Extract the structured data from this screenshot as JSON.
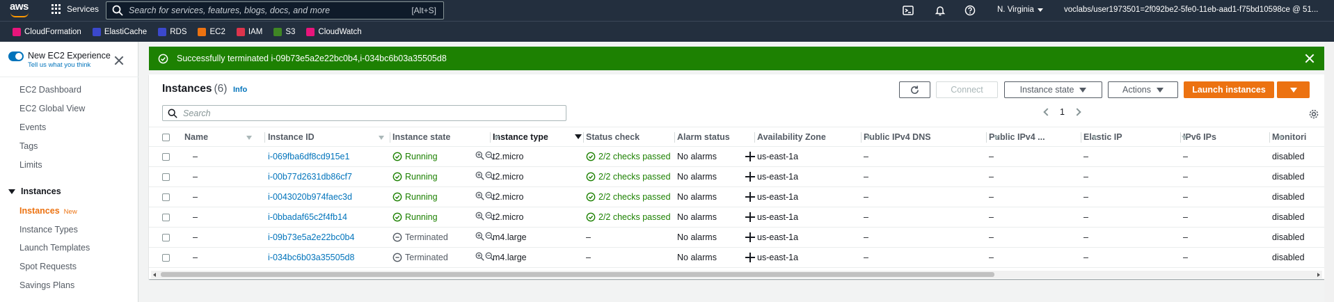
{
  "nav": {
    "logo_text": "aws",
    "services_label": "Services",
    "search_placeholder": "Search for services, features, blogs, docs, and more",
    "search_shortcut": "[Alt+S]",
    "region": "N. Virginia",
    "account": "voclabs/user1973501=2f092be2-5fe0-11eb-aad1-f75bd10598ce @ 51..."
  },
  "favorites": [
    {
      "label": "CloudFormation",
      "color": "#e7157b",
      "icon": "cloudformation-icon"
    },
    {
      "label": "ElastiCache",
      "color": "#3b48cc",
      "icon": "elasticache-icon"
    },
    {
      "label": "RDS",
      "color": "#3b48cc",
      "icon": "rds-icon"
    },
    {
      "label": "EC2",
      "color": "#ec7211",
      "icon": "ec2-icon"
    },
    {
      "label": "IAM",
      "color": "#dd344c",
      "icon": "iam-icon"
    },
    {
      "label": "S3",
      "color": "#3f8624",
      "icon": "s3-icon"
    },
    {
      "label": "CloudWatch",
      "color": "#e7157b",
      "icon": "cloudwatch-icon"
    }
  ],
  "sidebar": {
    "new_experience": "New EC2 Experience",
    "new_experience_sub": "Tell us what you think",
    "items": [
      "EC2 Dashboard",
      "EC2 Global View",
      "Events",
      "Tags",
      "Limits"
    ],
    "section_label": "Instances",
    "section_items": [
      {
        "label": "Instances",
        "tag": "New",
        "active": true
      },
      {
        "label": "Instance Types"
      },
      {
        "label": "Launch Templates"
      },
      {
        "label": "Spot Requests"
      },
      {
        "label": "Savings Plans"
      }
    ]
  },
  "flash": {
    "message": "Successfully terminated i-09b73e5a2e22bc0b4,i-034bc6b03a35505d8",
    "color": "#1d8102"
  },
  "panel": {
    "title": "Instances",
    "count": "(6)",
    "info": "Info",
    "connect": "Connect",
    "instance_state": "Instance state",
    "actions": "Actions",
    "launch": "Launch instances",
    "search_placeholder": "Search",
    "page": "1"
  },
  "table": {
    "columns": [
      "Name",
      "Instance ID",
      "Instance state",
      "Instance type",
      "Status check",
      "Alarm status",
      "Availability Zone",
      "Public IPv4 DNS",
      "Public IPv4 ...",
      "Elastic IP",
      "IPv6 IPs",
      "Monitori"
    ],
    "rows": [
      {
        "name": "–",
        "id": "i-069fba6df8cd915e1",
        "state": "Running",
        "type": "t2.micro",
        "check": "2/2 checks passed",
        "alarm": "No alarms",
        "az": "us-east-1a",
        "dns": "–",
        "ipv4": "–",
        "eip": "–",
        "ipv6": "–",
        "mon": "disabled"
      },
      {
        "name": "–",
        "id": "i-00b77d2631db86cf7",
        "state": "Running",
        "type": "t2.micro",
        "check": "2/2 checks passed",
        "alarm": "No alarms",
        "az": "us-east-1a",
        "dns": "–",
        "ipv4": "–",
        "eip": "–",
        "ipv6": "–",
        "mon": "disabled"
      },
      {
        "name": "–",
        "id": "i-0043020b974faec3d",
        "state": "Running",
        "type": "t2.micro",
        "check": "2/2 checks passed",
        "alarm": "No alarms",
        "az": "us-east-1a",
        "dns": "–",
        "ipv4": "–",
        "eip": "–",
        "ipv6": "–",
        "mon": "disabled"
      },
      {
        "name": "–",
        "id": "i-0bbadaf65c2f4fb14",
        "state": "Running",
        "type": "t2.micro",
        "check": "2/2 checks passed",
        "alarm": "No alarms",
        "az": "us-east-1a",
        "dns": "–",
        "ipv4": "–",
        "eip": "–",
        "ipv6": "–",
        "mon": "disabled"
      },
      {
        "name": "–",
        "id": "i-09b73e5a2e22bc0b4",
        "state": "Terminated",
        "type": "m4.large",
        "check": "–",
        "alarm": "No alarms",
        "az": "us-east-1a",
        "dns": "–",
        "ipv4": "–",
        "eip": "–",
        "ipv6": "–",
        "mon": "disabled"
      },
      {
        "name": "–",
        "id": "i-034bc6b03a35505d8",
        "state": "Terminated",
        "type": "m4.large",
        "check": "–",
        "alarm": "No alarms",
        "az": "us-east-1a",
        "dns": "–",
        "ipv4": "–",
        "eip": "–",
        "ipv6": "–",
        "mon": "disabled"
      }
    ]
  },
  "colors": {
    "nav_bg": "#232f3e",
    "accent": "#ec7211",
    "link": "#0073bb",
    "success": "#1d8102"
  }
}
